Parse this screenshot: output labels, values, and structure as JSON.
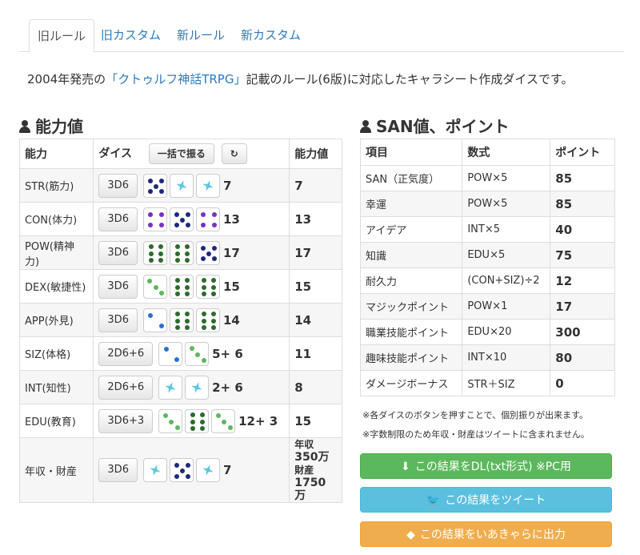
{
  "tabs": [
    "旧ルール",
    "旧カスタム",
    "新ルール",
    "新カスタム"
  ],
  "intro": {
    "pre": "2004年発売の",
    "link": "「クトゥルフ神話TRPG」",
    "post": "記載のルール(6版)に対応したキャラシート作成ダイスです。"
  },
  "abilities": {
    "title": "能力値",
    "headers": {
      "name": "能力",
      "dice": "ダイス",
      "roll_all": "一括で振る",
      "value": "能力値"
    },
    "rows": [
      {
        "name": "STR(筋力)",
        "btn": "3D6",
        "total": "7",
        "value": "7"
      },
      {
        "name": "CON(体力)",
        "btn": "3D6",
        "total": "13",
        "value": "13"
      },
      {
        "name": "POW(精神力)",
        "btn": "3D6",
        "total": "17",
        "value": "17"
      },
      {
        "name": "DEX(敏捷性)",
        "btn": "3D6",
        "total": "15",
        "value": "15"
      },
      {
        "name": "APP(外見)",
        "btn": "3D6",
        "total": "14",
        "value": "14"
      },
      {
        "name": "SIZ(体格)",
        "btn": "2D6+6",
        "total": "5+ 6",
        "value": "11"
      },
      {
        "name": "INT(知性)",
        "btn": "2D6+6",
        "total": "2+ 6",
        "value": "8"
      },
      {
        "name": "EDU(教育)",
        "btn": "3D6+3",
        "total": "12+ 3",
        "value": "15"
      },
      {
        "name": "年収・財産",
        "btn": "3D6",
        "total": "7"
      }
    ],
    "income": {
      "label1": "年収",
      "value1": "350万",
      "label2": "財産",
      "value2": "1750万"
    }
  },
  "san": {
    "title": "SAN値、ポイント",
    "headers": {
      "item": "項目",
      "formula": "数式",
      "point": "ポイント"
    },
    "rows": [
      {
        "item": "SAN（正気度）",
        "formula": "POW×5",
        "point": "85"
      },
      {
        "item": "幸運",
        "formula": "POW×5",
        "point": "85"
      },
      {
        "item": "アイデア",
        "formula": "INT×5",
        "point": "40"
      },
      {
        "item": "知識",
        "formula": "EDU×5",
        "point": "75"
      },
      {
        "item": "耐久力",
        "formula": "(CON+SIZ)÷2",
        "point": "12"
      },
      {
        "item": "マジックポイント",
        "formula": "POW×1",
        "point": "17"
      },
      {
        "item": "職業技能ポイント",
        "formula": "EDU×20",
        "point": "300"
      },
      {
        "item": "趣味技能ポイント",
        "formula": "INT×10",
        "point": "80"
      },
      {
        "item": "ダメージボーナス",
        "formula": "STR＋SIZ",
        "point": "0"
      }
    ]
  },
  "notes": [
    "※各ダイスのボタンを押すことで、個別振りが出来ます。",
    "※字数制限のため年収・財産はツイートに含まれません。"
  ],
  "buttons": {
    "dl": "この結果をDL(txt形式) ※PC用",
    "tweet": "この結果をツイート",
    "iachara": "この結果をいあきゃらに出力"
  },
  "colors": {
    "link": "#2a7bbf",
    "green": "#5cb85c",
    "blue": "#5bc0de",
    "orange": "#f0ad4e"
  }
}
